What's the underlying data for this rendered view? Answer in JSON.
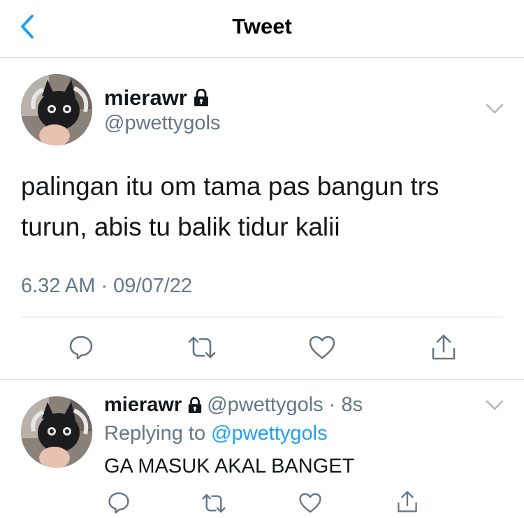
{
  "header": {
    "title": "Tweet"
  },
  "main_tweet": {
    "display_name": "mierawr",
    "handle": "@pwettygols",
    "text_line1": "palingan itu om tama pas bangun trs",
    "text_line2": "turun, abis tu balik tidur kalii",
    "timestamp": "6.32 AM · 09/07/22"
  },
  "reply_tweet": {
    "display_name": "mierawr",
    "handle": "@pwettygols",
    "separator": " · ",
    "age": "8s",
    "replying_prefix": "Replying to ",
    "replying_handle": "@pwettygols",
    "text": "GA MASUK AKAL BANGET"
  },
  "icons": [
    "back-arrow-icon",
    "lock-icon",
    "chevron-down-icon",
    "reply-icon",
    "retweet-icon",
    "like-icon",
    "share-icon"
  ],
  "colors": {
    "accent": "#1da1f2",
    "secondary_text": "#657786",
    "icon_gray": "#657786"
  }
}
